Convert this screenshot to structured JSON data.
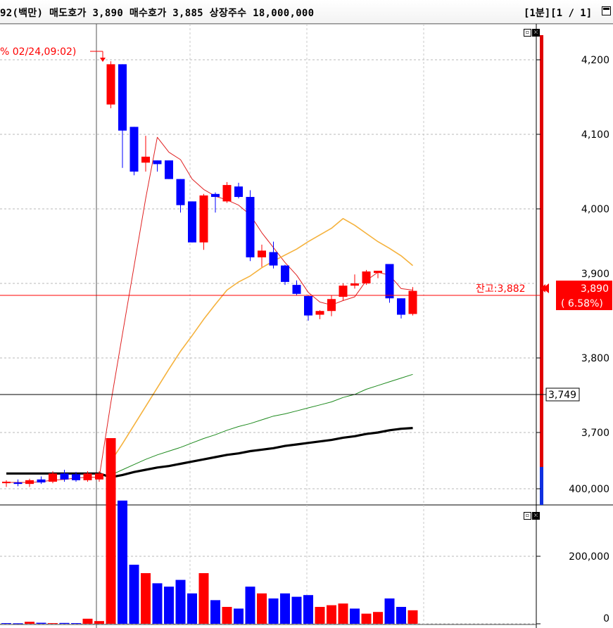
{
  "header": {
    "stock_info": "92(백만) 매도호가 3,890 매수호가 3,885 상장주수 18,000,000",
    "period": "[1분][1 / 1]"
  },
  "price_pane": {
    "annotation": "% 02/24,09:02)",
    "remain_label": "잔고:3,882",
    "current_price": "3,890",
    "change_pct": "( 6.58%)",
    "crosshair_price": "3,749",
    "partial_axis_label": "3,900",
    "axis_labels": [
      "4,200",
      "4,100",
      "4,000",
      "3,800",
      "3,700"
    ]
  },
  "volume_pane": {
    "axis_labels": [
      "400,000",
      "200,000",
      "0"
    ]
  },
  "colors": {
    "up": "#ff0000",
    "down": "#0000ff",
    "ma5": "#e02020",
    "ma20": "#f5b23d",
    "ma60": "#1e8a1e",
    "ma120": "#000000"
  },
  "chart_data": {
    "type": "candlestick",
    "interval": "1분",
    "price_ylim": [
      3600,
      4240
    ],
    "volume_ylim": [
      0,
      560000
    ],
    "candles": [
      {
        "o": 3632,
        "h": 3636,
        "l": 3627,
        "c": 3634
      },
      {
        "o": 3633,
        "h": 3637,
        "l": 3628,
        "c": 3631
      },
      {
        "o": 3631,
        "h": 3638,
        "l": 3627,
        "c": 3636
      },
      {
        "o": 3637,
        "h": 3641,
        "l": 3631,
        "c": 3633
      },
      {
        "o": 3634,
        "h": 3648,
        "l": 3632,
        "c": 3645
      },
      {
        "o": 3645,
        "h": 3650,
        "l": 3634,
        "c": 3637
      },
      {
        "o": 3644,
        "h": 3647,
        "l": 3634,
        "c": 3636
      },
      {
        "o": 3636,
        "h": 3648,
        "l": 3634,
        "c": 3645
      },
      {
        "o": 3637,
        "h": 3648,
        "l": 3634,
        "c": 3645
      },
      {
        "o": 4140,
        "h": 4198,
        "l": 4135,
        "c": 4194
      },
      {
        "o": 4194,
        "h": 4194,
        "l": 4055,
        "c": 4105
      },
      {
        "o": 4110,
        "h": 4110,
        "l": 4045,
        "c": 4050
      },
      {
        "o": 4062,
        "h": 4098,
        "l": 4050,
        "c": 4070
      },
      {
        "o": 4065,
        "h": 4065,
        "l": 4050,
        "c": 4060
      },
      {
        "o": 4065,
        "h": 4065,
        "l": 4040,
        "c": 4040
      },
      {
        "o": 4040,
        "h": 4040,
        "l": 3995,
        "c": 4005
      },
      {
        "o": 4010,
        "h": 4010,
        "l": 3955,
        "c": 3955
      },
      {
        "o": 3955,
        "h": 4020,
        "l": 3945,
        "c": 4018
      },
      {
        "o": 4020,
        "h": 4022,
        "l": 3995,
        "c": 4016
      },
      {
        "o": 4010,
        "h": 4036,
        "l": 4008,
        "c": 4032
      },
      {
        "o": 4030,
        "h": 4035,
        "l": 4014,
        "c": 4016
      },
      {
        "o": 4016,
        "h": 4025,
        "l": 3930,
        "c": 3935
      },
      {
        "o": 3935,
        "h": 3952,
        "l": 3922,
        "c": 3944
      },
      {
        "o": 3942,
        "h": 3956,
        "l": 3920,
        "c": 3924
      },
      {
        "o": 3924,
        "h": 3925,
        "l": 3898,
        "c": 3902
      },
      {
        "o": 3898,
        "h": 3904,
        "l": 3884,
        "c": 3886
      },
      {
        "o": 3883,
        "h": 3884,
        "l": 3850,
        "c": 3857
      },
      {
        "o": 3858,
        "h": 3864,
        "l": 3852,
        "c": 3863
      },
      {
        "o": 3863,
        "h": 3884,
        "l": 3856,
        "c": 3879
      },
      {
        "o": 3882,
        "h": 3900,
        "l": 3877,
        "c": 3897
      },
      {
        "o": 3897,
        "h": 3912,
        "l": 3893,
        "c": 3900
      },
      {
        "o": 3900,
        "h": 3918,
        "l": 3898,
        "c": 3916
      },
      {
        "o": 3914,
        "h": 3917,
        "l": 3907,
        "c": 3917
      },
      {
        "o": 3926,
        "h": 3926,
        "l": 3874,
        "c": 3880
      },
      {
        "o": 3880,
        "h": 3880,
        "l": 3853,
        "c": 3858
      },
      {
        "o": 3859,
        "h": 3895,
        "l": 3857,
        "c": 3890
      }
    ],
    "volumes": [
      {
        "v": 2000,
        "up": false
      },
      {
        "v": 1500,
        "up": false
      },
      {
        "v": 6000,
        "up": true
      },
      {
        "v": 3000,
        "up": false
      },
      {
        "v": 2000,
        "up": true
      },
      {
        "v": 2500,
        "up": false
      },
      {
        "v": 2000,
        "up": false
      },
      {
        "v": 15000,
        "up": true
      },
      {
        "v": 8000,
        "up": true
      },
      {
        "v": 550000,
        "up": true
      },
      {
        "v": 365000,
        "up": false
      },
      {
        "v": 175000,
        "up": false
      },
      {
        "v": 150000,
        "up": true
      },
      {
        "v": 120000,
        "up": false
      },
      {
        "v": 110000,
        "up": false
      },
      {
        "v": 130000,
        "up": false
      },
      {
        "v": 90000,
        "up": false
      },
      {
        "v": 150000,
        "up": true
      },
      {
        "v": 70000,
        "up": false
      },
      {
        "v": 50000,
        "up": true
      },
      {
        "v": 45000,
        "up": false
      },
      {
        "v": 110000,
        "up": false
      },
      {
        "v": 90000,
        "up": true
      },
      {
        "v": 75000,
        "up": false
      },
      {
        "v": 90000,
        "up": false
      },
      {
        "v": 80000,
        "up": false
      },
      {
        "v": 85000,
        "up": false
      },
      {
        "v": 50000,
        "up": true
      },
      {
        "v": 55000,
        "up": true
      },
      {
        "v": 60000,
        "up": true
      },
      {
        "v": 45000,
        "up": false
      },
      {
        "v": 30000,
        "up": true
      },
      {
        "v": 35000,
        "up": true
      },
      {
        "v": 75000,
        "up": false
      },
      {
        "v": 50000,
        "up": false
      },
      {
        "v": 40000,
        "up": true
      }
    ],
    "ma_series": [
      {
        "key": "ma5",
        "values": [
          3633,
          3633,
          3633,
          3634,
          3636,
          3637,
          3639,
          3640,
          3640,
          3740,
          3832,
          3923,
          4014,
          4096,
          4076,
          4066,
          4040,
          4026,
          4017,
          4012,
          4005,
          3992,
          3968,
          3948,
          3928,
          3911,
          3888,
          3875,
          3871,
          3877,
          3882,
          3904,
          3915,
          3911,
          3893,
          3891
        ]
      },
      {
        "key": "ma20",
        "values": [
          null,
          null,
          null,
          null,
          null,
          null,
          null,
          null,
          null,
          3661,
          3685,
          3710,
          3735,
          3760,
          3785,
          3809,
          3830,
          3852,
          3872,
          3891,
          3902,
          3910,
          3921,
          3930,
          3938,
          3946,
          3956,
          3965,
          3974,
          3987,
          3978,
          3967,
          3956,
          3947,
          3937,
          3924
        ]
      },
      {
        "key": "ma60",
        "values": [
          null,
          null,
          null,
          null,
          null,
          null,
          null,
          null,
          null,
          3643,
          3650,
          3657,
          3664,
          3670,
          3675,
          3680,
          3686,
          3692,
          3697,
          3703,
          3708,
          3712,
          3717,
          3722,
          3725,
          3729,
          3733,
          3737,
          3741,
          3747,
          3751,
          3758,
          3763,
          3768,
          3773,
          3778
        ]
      },
      {
        "key": "ma120",
        "values": [
          3645,
          3645,
          3645,
          3645,
          3645,
          3645,
          3645,
          3645,
          3645,
          3640,
          3643,
          3647,
          3650,
          3653,
          3655,
          3658,
          3661,
          3664,
          3667,
          3670,
          3672,
          3675,
          3677,
          3679,
          3682,
          3684,
          3686,
          3688,
          3690,
          3693,
          3695,
          3698,
          3700,
          3703,
          3705,
          3706
        ]
      }
    ]
  }
}
